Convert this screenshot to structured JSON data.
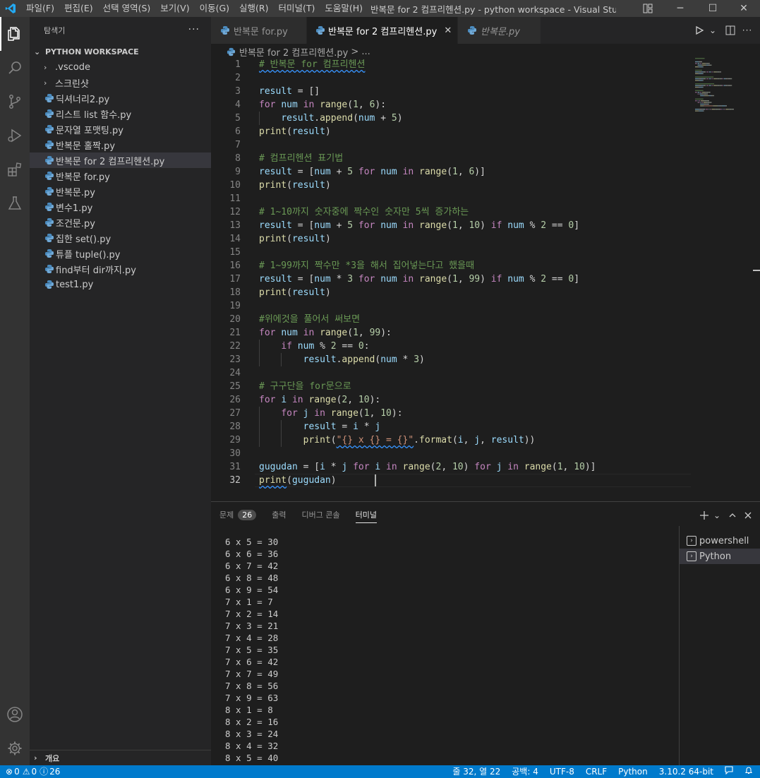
{
  "titlebar": {
    "menu": [
      "파일(F)",
      "편집(E)",
      "선택 영역(S)",
      "보기(V)",
      "이동(G)",
      "실행(R)",
      "터미널(T)",
      "도움말(H)"
    ],
    "title": "반복문 for 2 컴프리헨션.py - python workspace - Visual Studio ...",
    "minimize": "─",
    "maximize": "☐",
    "close": "✕"
  },
  "sidebar": {
    "header": "탐색기",
    "more": "···",
    "workspace": "PYTHON WORKSPACE",
    "folders": [
      ".vscode",
      "스크린샷"
    ],
    "files": [
      "딕셔너리2.py",
      "리스트 list 함수.py",
      "문자열 포맷팅.py",
      "반복문 홀짝.py",
      "반복문 for 2 컴프리헨션.py",
      "반복문 for.py",
      "반복문.py",
      "변수1.py",
      "조건문.py",
      "집한 set().py",
      "튜플 tuple().py",
      "find부터 dir까지.py",
      "test1.py"
    ],
    "outline": "개요"
  },
  "tabs": [
    {
      "label": "반복문 for.py"
    },
    {
      "label": "반복문 for 2 컴프리헨션.py"
    },
    {
      "label": "반복문.py"
    }
  ],
  "breadcrumb": {
    "file": "반복문 for 2 컴프리헨션.py",
    "sep": "> ..."
  },
  "editor": {
    "cursor_line": 32,
    "lines": [
      [
        [
          "cm",
          "# 반복문 for 컴프리헨션"
        ]
      ],
      [],
      [
        [
          "var",
          "result"
        ],
        [
          "op",
          " = []"
        ]
      ],
      [
        [
          "kw",
          "for"
        ],
        [
          "op",
          " "
        ],
        [
          "var",
          "num"
        ],
        [
          "op",
          " "
        ],
        [
          "kw",
          "in"
        ],
        [
          "op",
          " "
        ],
        [
          "fn",
          "range"
        ],
        [
          "op",
          "("
        ],
        [
          "num",
          "1"
        ],
        [
          "op",
          ", "
        ],
        [
          "num",
          "6"
        ],
        [
          "op",
          "):"
        ]
      ],
      [
        [
          "op",
          "    "
        ],
        [
          "var",
          "result"
        ],
        [
          "op",
          "."
        ],
        [
          "fn",
          "append"
        ],
        [
          "op",
          "("
        ],
        [
          "var",
          "num"
        ],
        [
          "op",
          " + "
        ],
        [
          "num",
          "5"
        ],
        [
          "op",
          ")"
        ]
      ],
      [
        [
          "fn",
          "print"
        ],
        [
          "op",
          "("
        ],
        [
          "var",
          "result"
        ],
        [
          "op",
          ")"
        ]
      ],
      [],
      [
        [
          "cm",
          "# 컴프리헨션 표기법"
        ]
      ],
      [
        [
          "var",
          "result"
        ],
        [
          "op",
          " = ["
        ],
        [
          "var",
          "num"
        ],
        [
          "op",
          " + "
        ],
        [
          "num",
          "5"
        ],
        [
          "op",
          " "
        ],
        [
          "kw",
          "for"
        ],
        [
          "op",
          " "
        ],
        [
          "var",
          "num"
        ],
        [
          "op",
          " "
        ],
        [
          "kw",
          "in"
        ],
        [
          "op",
          " "
        ],
        [
          "fn",
          "range"
        ],
        [
          "op",
          "("
        ],
        [
          "num",
          "1"
        ],
        [
          "op",
          ", "
        ],
        [
          "num",
          "6"
        ],
        [
          "op",
          ")]"
        ]
      ],
      [
        [
          "fn",
          "print"
        ],
        [
          "op",
          "("
        ],
        [
          "var",
          "result"
        ],
        [
          "op",
          ")"
        ]
      ],
      [],
      [
        [
          "cm",
          "# 1~10까지 숫자중에 짝수인 숫자만 5씩 증가하는"
        ]
      ],
      [
        [
          "var",
          "result"
        ],
        [
          "op",
          " = ["
        ],
        [
          "var",
          "num"
        ],
        [
          "op",
          " + "
        ],
        [
          "num",
          "5"
        ],
        [
          "op",
          " "
        ],
        [
          "kw",
          "for"
        ],
        [
          "op",
          " "
        ],
        [
          "var",
          "num"
        ],
        [
          "op",
          " "
        ],
        [
          "kw",
          "in"
        ],
        [
          "op",
          " "
        ],
        [
          "fn",
          "range"
        ],
        [
          "op",
          "("
        ],
        [
          "num",
          "1"
        ],
        [
          "op",
          ", "
        ],
        [
          "num",
          "10"
        ],
        [
          "op",
          ") "
        ],
        [
          "kw",
          "if"
        ],
        [
          "op",
          " "
        ],
        [
          "var",
          "num"
        ],
        [
          "op",
          " % "
        ],
        [
          "num",
          "2"
        ],
        [
          "op",
          " == "
        ],
        [
          "num",
          "0"
        ],
        [
          "op",
          "]"
        ]
      ],
      [
        [
          "fn",
          "print"
        ],
        [
          "op",
          "("
        ],
        [
          "var",
          "result"
        ],
        [
          "op",
          ")"
        ]
      ],
      [],
      [
        [
          "cm",
          "# 1~99까지 짝수만 *3을 해서 집어넣는다고 했을때"
        ]
      ],
      [
        [
          "var",
          "result"
        ],
        [
          "op",
          " = ["
        ],
        [
          "var",
          "num"
        ],
        [
          "op",
          " * "
        ],
        [
          "num",
          "3"
        ],
        [
          "op",
          " "
        ],
        [
          "kw",
          "for"
        ],
        [
          "op",
          " "
        ],
        [
          "var",
          "num"
        ],
        [
          "op",
          " "
        ],
        [
          "kw",
          "in"
        ],
        [
          "op",
          " "
        ],
        [
          "fn",
          "range"
        ],
        [
          "op",
          "("
        ],
        [
          "num",
          "1"
        ],
        [
          "op",
          ", "
        ],
        [
          "num",
          "99"
        ],
        [
          "op",
          ") "
        ],
        [
          "kw",
          "if"
        ],
        [
          "op",
          " "
        ],
        [
          "var",
          "num"
        ],
        [
          "op",
          " % "
        ],
        [
          "num",
          "2"
        ],
        [
          "op",
          " == "
        ],
        [
          "num",
          "0"
        ],
        [
          "op",
          "]"
        ]
      ],
      [
        [
          "fn",
          "print"
        ],
        [
          "op",
          "("
        ],
        [
          "var",
          "result"
        ],
        [
          "op",
          ")"
        ]
      ],
      [],
      [
        [
          "cm",
          "#위에것을 풀어서 써보면"
        ]
      ],
      [
        [
          "kw",
          "for"
        ],
        [
          "op",
          " "
        ],
        [
          "var",
          "num"
        ],
        [
          "op",
          " "
        ],
        [
          "kw",
          "in"
        ],
        [
          "op",
          " "
        ],
        [
          "fn",
          "range"
        ],
        [
          "op",
          "("
        ],
        [
          "num",
          "1"
        ],
        [
          "op",
          ", "
        ],
        [
          "num",
          "99"
        ],
        [
          "op",
          "):"
        ]
      ],
      [
        [
          "op",
          "    "
        ],
        [
          "kw",
          "if"
        ],
        [
          "op",
          " "
        ],
        [
          "var",
          "num"
        ],
        [
          "op",
          " % "
        ],
        [
          "num",
          "2"
        ],
        [
          "op",
          " == "
        ],
        [
          "num",
          "0"
        ],
        [
          "op",
          ":"
        ]
      ],
      [
        [
          "op",
          "        "
        ],
        [
          "var",
          "result"
        ],
        [
          "op",
          "."
        ],
        [
          "fn",
          "append"
        ],
        [
          "op",
          "("
        ],
        [
          "var",
          "num"
        ],
        [
          "op",
          " * "
        ],
        [
          "num",
          "3"
        ],
        [
          "op",
          ")"
        ]
      ],
      [],
      [
        [
          "cm",
          "# 구구단을 for문으로"
        ]
      ],
      [
        [
          "kw",
          "for"
        ],
        [
          "op",
          " "
        ],
        [
          "var",
          "i"
        ],
        [
          "op",
          " "
        ],
        [
          "kw",
          "in"
        ],
        [
          "op",
          " "
        ],
        [
          "fn",
          "range"
        ],
        [
          "op",
          "("
        ],
        [
          "num",
          "2"
        ],
        [
          "op",
          ", "
        ],
        [
          "num",
          "10"
        ],
        [
          "op",
          "):"
        ]
      ],
      [
        [
          "op",
          "    "
        ],
        [
          "kw",
          "for"
        ],
        [
          "op",
          " "
        ],
        [
          "var",
          "j"
        ],
        [
          "op",
          " "
        ],
        [
          "kw",
          "in"
        ],
        [
          "op",
          " "
        ],
        [
          "fn",
          "range"
        ],
        [
          "op",
          "("
        ],
        [
          "num",
          "1"
        ],
        [
          "op",
          ", "
        ],
        [
          "num",
          "10"
        ],
        [
          "op",
          "):"
        ]
      ],
      [
        [
          "op",
          "        "
        ],
        [
          "var",
          "result"
        ],
        [
          "op",
          " = "
        ],
        [
          "var",
          "i"
        ],
        [
          "op",
          " * "
        ],
        [
          "var",
          "j"
        ]
      ],
      [
        [
          "op",
          "        "
        ],
        [
          "fn",
          "print"
        ],
        [
          "op",
          "("
        ],
        [
          "str",
          "\"{} x {} = {}\""
        ],
        [
          "op",
          "."
        ],
        [
          "fn",
          "format"
        ],
        [
          "op",
          "("
        ],
        [
          "var",
          "i"
        ],
        [
          "op",
          ", "
        ],
        [
          "var",
          "j"
        ],
        [
          "op",
          ", "
        ],
        [
          "var",
          "result"
        ],
        [
          "op",
          "))"
        ]
      ],
      [],
      [
        [
          "var",
          "gugudan"
        ],
        [
          "op",
          " = ["
        ],
        [
          "var",
          "i"
        ],
        [
          "op",
          " * "
        ],
        [
          "var",
          "j"
        ],
        [
          "op",
          " "
        ],
        [
          "kw",
          "for"
        ],
        [
          "op",
          " "
        ],
        [
          "var",
          "i"
        ],
        [
          "op",
          " "
        ],
        [
          "kw",
          "in"
        ],
        [
          "op",
          " "
        ],
        [
          "fn",
          "range"
        ],
        [
          "op",
          "("
        ],
        [
          "num",
          "2"
        ],
        [
          "op",
          ", "
        ],
        [
          "num",
          "10"
        ],
        [
          "op",
          ") "
        ],
        [
          "kw",
          "for"
        ],
        [
          "op",
          " "
        ],
        [
          "var",
          "j"
        ],
        [
          "op",
          " "
        ],
        [
          "kw",
          "in"
        ],
        [
          "op",
          " "
        ],
        [
          "fn",
          "range"
        ],
        [
          "op",
          "("
        ],
        [
          "num",
          "1"
        ],
        [
          "op",
          ", "
        ],
        [
          "num",
          "10"
        ],
        [
          "op",
          ")]"
        ]
      ],
      [
        [
          "fn",
          "print"
        ],
        [
          "op",
          "("
        ],
        [
          "var",
          "gugudan"
        ],
        [
          "op",
          ")"
        ]
      ]
    ]
  },
  "panel": {
    "tabs": [
      "문제",
      "출력",
      "디버그 콘솔",
      "터미널"
    ],
    "problems_count": "26",
    "terminal_lines": [
      "6 x 5 = 30",
      "6 x 6 = 36",
      "6 x 7 = 42",
      "6 x 8 = 48",
      "6 x 9 = 54",
      "7 x 1 = 7",
      "7 x 2 = 14",
      "7 x 3 = 21",
      "7 x 4 = 28",
      "7 x 5 = 35",
      "7 x 6 = 42",
      "7 x 7 = 49",
      "7 x 8 = 56",
      "7 x 9 = 63",
      "8 x 1 = 8",
      "8 x 2 = 16",
      "8 x 3 = 24",
      "8 x 4 = 32",
      "8 x 5 = 40"
    ],
    "terminals": [
      "powershell",
      "Python"
    ]
  },
  "statusbar": {
    "errors": "0",
    "warnings": "0",
    "info": "26",
    "position": "줄 32, 열 22",
    "spaces": "공백: 4",
    "encoding": "UTF-8",
    "eol": "CRLF",
    "language": "Python",
    "interpreter": "3.10.2 64-bit"
  },
  "colors": {
    "accent": "#007acc",
    "keyword": "#c586c0",
    "function": "#dcdcaa",
    "variable": "#9cdcfe",
    "number": "#b5cea8",
    "string": "#ce9178",
    "comment": "#6a9955",
    "python_icon": "#4b8bbe"
  }
}
